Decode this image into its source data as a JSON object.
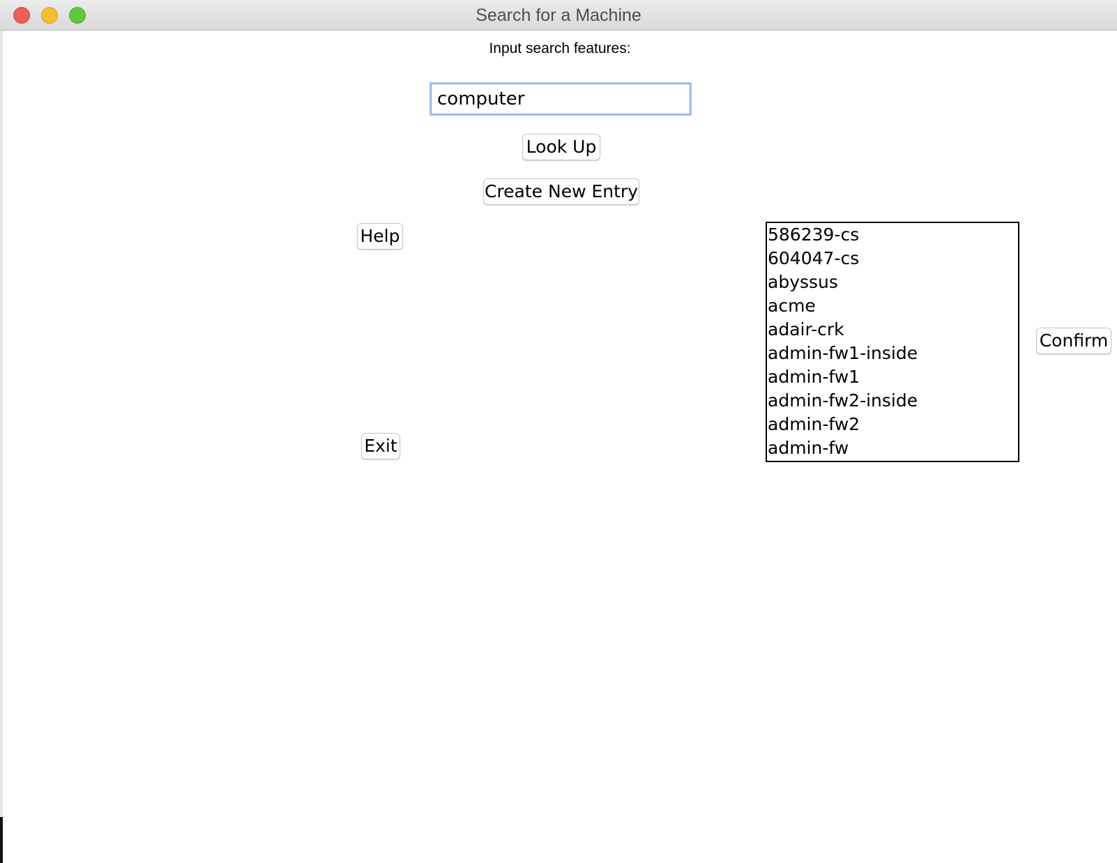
{
  "window": {
    "title": "Search for a Machine"
  },
  "search": {
    "label": "Input search features:",
    "value": "computer"
  },
  "buttons": {
    "lookup": "Look Up",
    "create": "Create New Entry",
    "help": "Help",
    "exit": "Exit",
    "confirm": "Confirm"
  },
  "results": {
    "items": [
      "586239-cs",
      "604047-cs",
      "abyssus",
      "acme",
      "adair-crk",
      "admin-fw1-inside",
      "admin-fw1",
      "admin-fw2-inside",
      "admin-fw2",
      "admin-fw"
    ]
  }
}
